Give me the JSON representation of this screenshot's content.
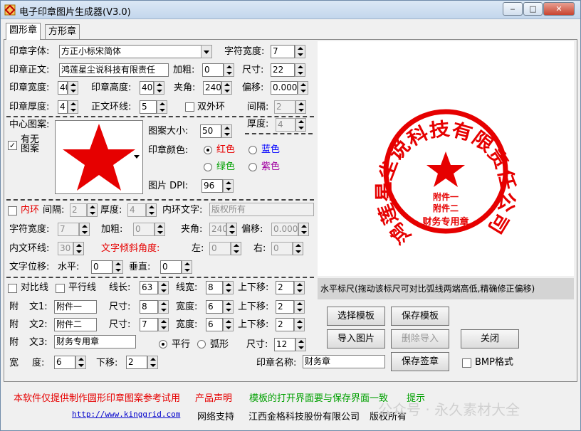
{
  "window": {
    "title": "电子印章图片生成器(V3.0)",
    "min": "‒",
    "max": "□",
    "close": "✕"
  },
  "tabs": [
    {
      "label": "圆形章"
    },
    {
      "label": "方形章"
    }
  ],
  "font": {
    "label": "印章字体:",
    "value": "方正小标宋简体"
  },
  "char_width": {
    "label": "字符宽度:",
    "value": "7"
  },
  "text": {
    "label": "印章正文:",
    "value": "鸿莲星尘说科技有限责任"
  },
  "bold": {
    "label": "加粗:",
    "value": "0"
  },
  "size": {
    "label": "尺寸:",
    "value": "22"
  },
  "seal_width": {
    "label": "印章宽度:",
    "value": "40"
  },
  "seal_height": {
    "label": "印章高度:",
    "value": "40"
  },
  "angle": {
    "label": "夹角:",
    "value": "240"
  },
  "offset": {
    "label": "偏移:",
    "value": "0.000"
  },
  "thickness": {
    "label": "印章厚度:",
    "value": "4"
  },
  "ring": {
    "label": "正文环线:",
    "value": "5"
  },
  "double_ring": {
    "label": "双外环"
  },
  "gap": {
    "label": "间隔:",
    "value": "2"
  },
  "center": {
    "label": "中心图案:",
    "has_label_1": "有无",
    "has_label_2": "图案"
  },
  "ring_thick": {
    "label": "厚度:",
    "value": "4"
  },
  "pattern_size": {
    "label": "图案大小:",
    "value": "50"
  },
  "color": {
    "label": "印章颜色:",
    "red": "红色",
    "blue": "蓝色",
    "green": "绿色",
    "purple": "紫色"
  },
  "dpi": {
    "label": "图片 DPI:",
    "value": "96"
  },
  "inner": {
    "label": "内环",
    "gap_label": "间隔:",
    "gap": "2",
    "thick_label": "厚度:",
    "thick": "4",
    "text_label": "内环文字:",
    "text": "版权所有"
  },
  "inner2": {
    "cw_label": "字符宽度:",
    "cw": "7",
    "bold_label": "加粗:",
    "bold": "0",
    "angle_label": "夹角:",
    "angle": "240",
    "offset_label": "偏移:",
    "offset": "0.000"
  },
  "inner3": {
    "ring_label": "内文环线:",
    "ring": "30",
    "tilt_label": "文字倾斜角度:",
    "left_label": "左:",
    "left": "0",
    "right_label": "右:",
    "right": "0"
  },
  "shift": {
    "label": "文字位移:",
    "h_label": "水平:",
    "h": "0",
    "v_label": "垂直:",
    "v": "0"
  },
  "line": {
    "contrast": "对比线",
    "parallel": "平行线",
    "len_label": "线长:",
    "len": "63",
    "w_label": "线宽:",
    "w": "8",
    "ud_label": "上下移:",
    "ud": "2"
  },
  "att1": {
    "label1": "附",
    "label2": "文1:",
    "text": "附件一",
    "size_label": "尺寸:",
    "size": "8",
    "w_label": "宽度:",
    "w": "6",
    "ud_label": "上下移:",
    "ud": "2"
  },
  "att2": {
    "label1": "附",
    "label2": "文2:",
    "text": "附件二",
    "size_label": "尺寸:",
    "size": "7",
    "w_label": "宽度:",
    "w": "6",
    "ud_label": "上下移:",
    "ud": "2"
  },
  "att3": {
    "label1": "附",
    "label2": "文3:",
    "text": "财务专用章",
    "parallel": "平行",
    "arc": "弧形",
    "size_label": "尺寸:",
    "size": "12"
  },
  "bottom": {
    "w_label1": "宽",
    "w_label2": "度:",
    "w": "6",
    "down_label": "下移:",
    "down": "2",
    "name_label": "印章名称:",
    "name": "财务章"
  },
  "buttons": {
    "select": "选择模板",
    "save_tpl": "保存模板",
    "import": "导入图片",
    "remove": "删除导入",
    "close": "关闭",
    "save_sig": "保存签章",
    "bmp": "BMP格式"
  },
  "ruler": "水平标尺(拖动该标尺可对比弧线两端高低,精确修正偏移)",
  "seal": {
    "ring_text": "鸿莲星尘说科技有限责任公司",
    "att1": "附件一",
    "att2": "附件二",
    "bottom_text": "财务专用章"
  },
  "footer": {
    "notice": "本软件仅提供制作圆形印章图案参考试用",
    "statement": "产品声明",
    "tip": "模板的打开界面要与保存界面一致",
    "hint": "提示",
    "url": "http://www.kinggrid.com",
    "support": "网络支持",
    "company": "江西金格科技股份有限公司",
    "copyright": "版权所有"
  },
  "watermark": "公众号 · 永久素材大全",
  "colors": {
    "seal": "#e60000"
  }
}
